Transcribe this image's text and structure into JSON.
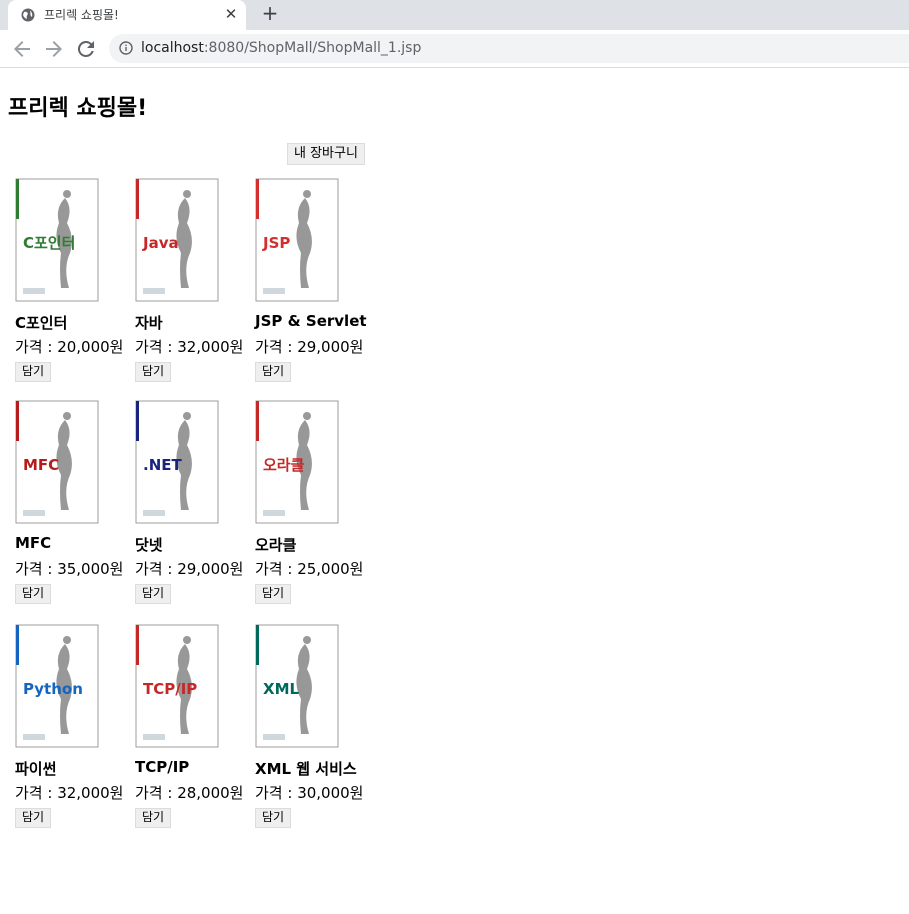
{
  "browser": {
    "tab_title": "프리렉 쇼핑몰!",
    "close_glyph": "✕",
    "new_tab_glyph": "+",
    "url_host": "localhost",
    "url_path": ":8080/ShopMall/ShopMall_1.jsp"
  },
  "page": {
    "heading": "프리렉 쇼핑몰!",
    "cart_button": "내 장바구니",
    "add_button": "담기"
  },
  "products": [
    {
      "name": "C포인터",
      "price": "가격 : 20,000원",
      "cover_color": "#2e7d32",
      "cover_text": "C포인터"
    },
    {
      "name": "자바",
      "price": "가격 : 32,000원",
      "cover_color": "#c62828",
      "cover_text": "Java"
    },
    {
      "name": "JSP & Servlet",
      "price": "가격 : 29,000원",
      "cover_color": "#d32f2f",
      "cover_text": "JSP"
    },
    {
      "name": "MFC",
      "price": "가격 : 35,000원",
      "cover_color": "#b71c1c",
      "cover_text": "MFC"
    },
    {
      "name": "닷넷",
      "price": "가격 : 29,000원",
      "cover_color": "#1a237e",
      "cover_text": ".NET"
    },
    {
      "name": "오라클",
      "price": "가격 : 25,000원",
      "cover_color": "#c62828",
      "cover_text": "오라클"
    },
    {
      "name": "파이썬",
      "price": "가격 : 32,000원",
      "cover_color": "#1565c0",
      "cover_text": "Python"
    },
    {
      "name": "TCP/IP",
      "price": "가격 : 28,000원",
      "cover_color": "#c62828",
      "cover_text": "TCP/IP"
    },
    {
      "name": "XML 웹 서비스",
      "price": "가격 : 30,000원",
      "cover_color": "#00695c",
      "cover_text": "XML"
    }
  ]
}
